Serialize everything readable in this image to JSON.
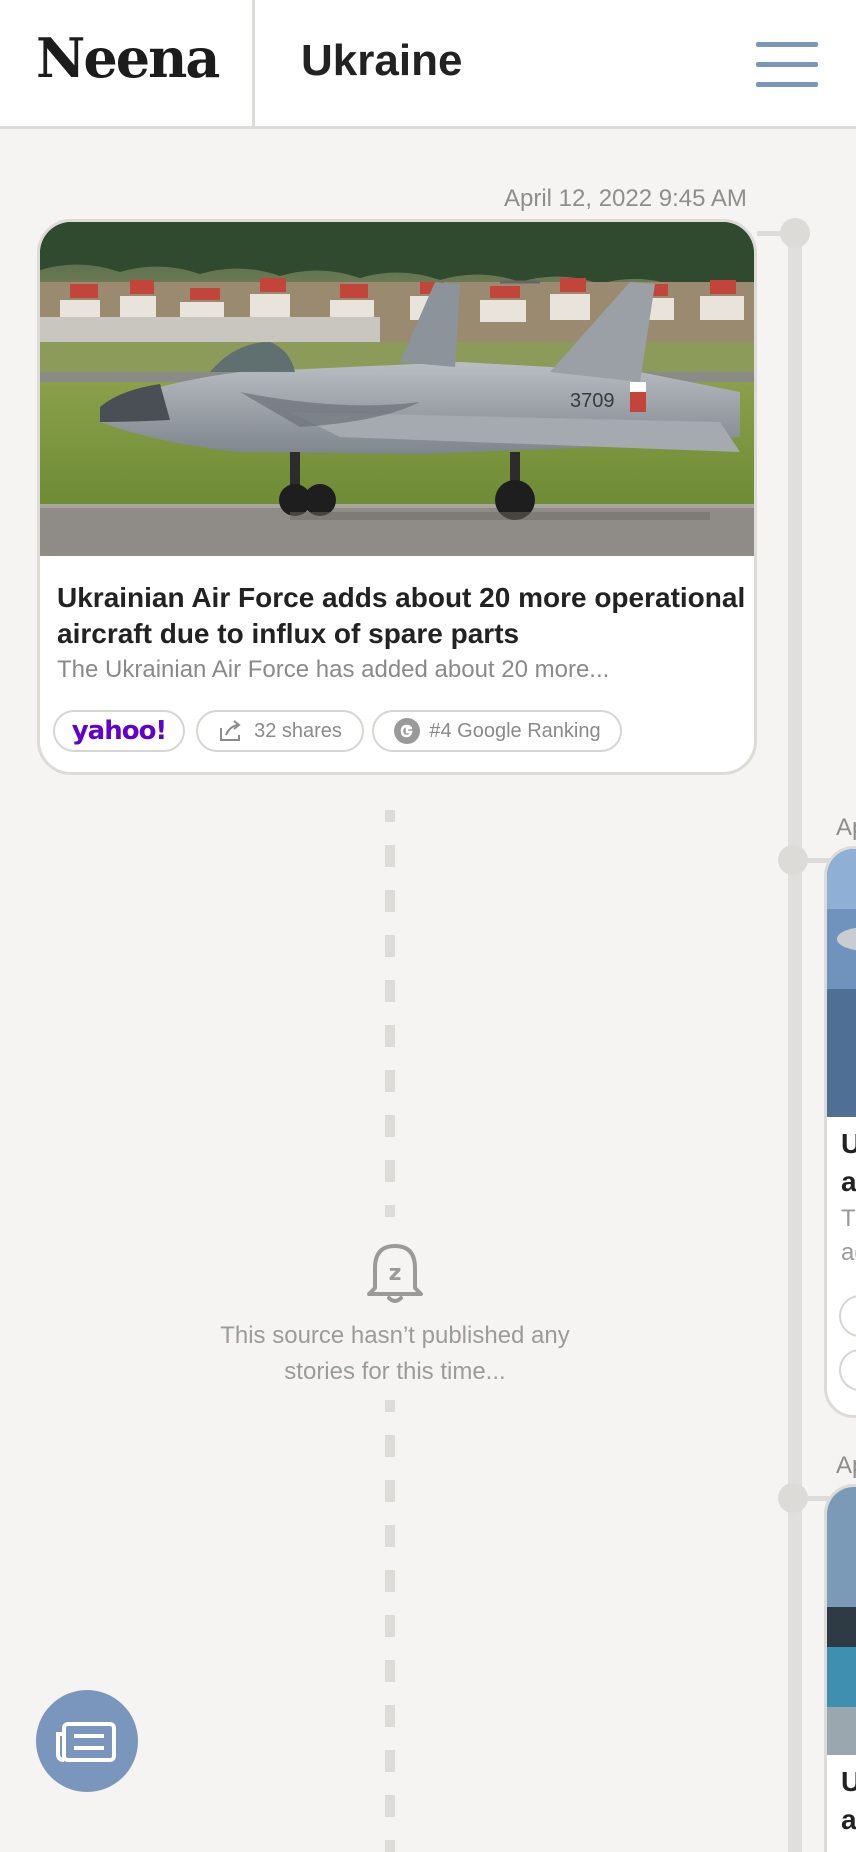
{
  "header": {
    "logo": "Neena",
    "topic": "Ukraine"
  },
  "timeline": {
    "main_card": {
      "timestamp": "April 12, 2022 9:45 AM",
      "title": "Ukrainian Air Force adds about 20 more operational aircraft due to influx of spare parts",
      "summary": "The Ukrainian Air Force has added about 20 more...",
      "source": "yahoo!",
      "shares": "32 shares",
      "ranking": "#4 Google Ranking",
      "image_icon": "fighter-jet-photo"
    },
    "empty_state": {
      "icon": "bell-snooze-icon",
      "message": "This source hasn’t published any stories for this time..."
    },
    "side_cards": [
      {
        "timestamp_fragment": "Ap",
        "title_line1": "U",
        "title_line2": "a",
        "summary_line1": "Th",
        "summary_line2": "ad"
      },
      {
        "timestamp_fragment": "Ap",
        "title_line1": "U",
        "title_line2": "a"
      }
    ]
  },
  "fab": {
    "icon": "news-feed-icon"
  },
  "colors": {
    "accent": "#7b96bd",
    "yahoo": "#6001d2",
    "background": "#f5f4f2"
  }
}
